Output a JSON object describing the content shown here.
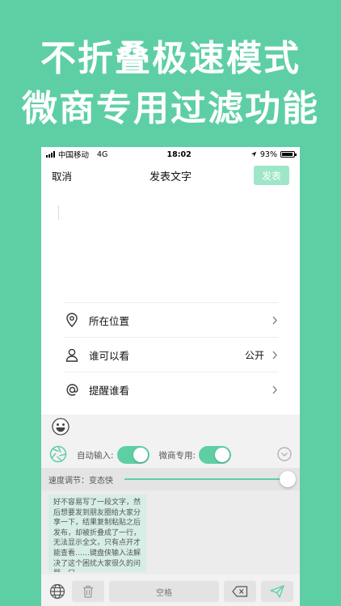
{
  "promo": {
    "line1": "不折叠极速模式",
    "line2": "微商专用过滤功能",
    "background": "#5ecfa5"
  },
  "status_bar": {
    "carrier": "中国移动",
    "network": "4G",
    "time": "18:02",
    "battery": "93%"
  },
  "nav": {
    "cancel": "取消",
    "title": "发表文字",
    "post": "发表"
  },
  "menu": [
    {
      "icon": "location-pin-icon",
      "label": "所在位置",
      "value": ""
    },
    {
      "icon": "person-icon",
      "label": "谁可以看",
      "value": "公开"
    },
    {
      "icon": "at-sign-icon",
      "label": "提醒谁看",
      "value": ""
    }
  ],
  "keyboard": {
    "auto_input_label": "自动输入:",
    "auto_input_on": true,
    "weishang_label": "微商专用:",
    "weishang_on": true,
    "speed_label": "速度调节：变态快",
    "speed_level": 1.0,
    "suggestion": "好不容易写了一段文字，然后想要发到朋友圈给大家分享一下，结果复制粘贴之后发布，却被折叠成了一行，无法显示全文，只有点开才能查看……键盘侠输入法解决了这个困扰大家很久的问题。只…",
    "space_label": "空格",
    "accent": "#5ecfa5"
  }
}
